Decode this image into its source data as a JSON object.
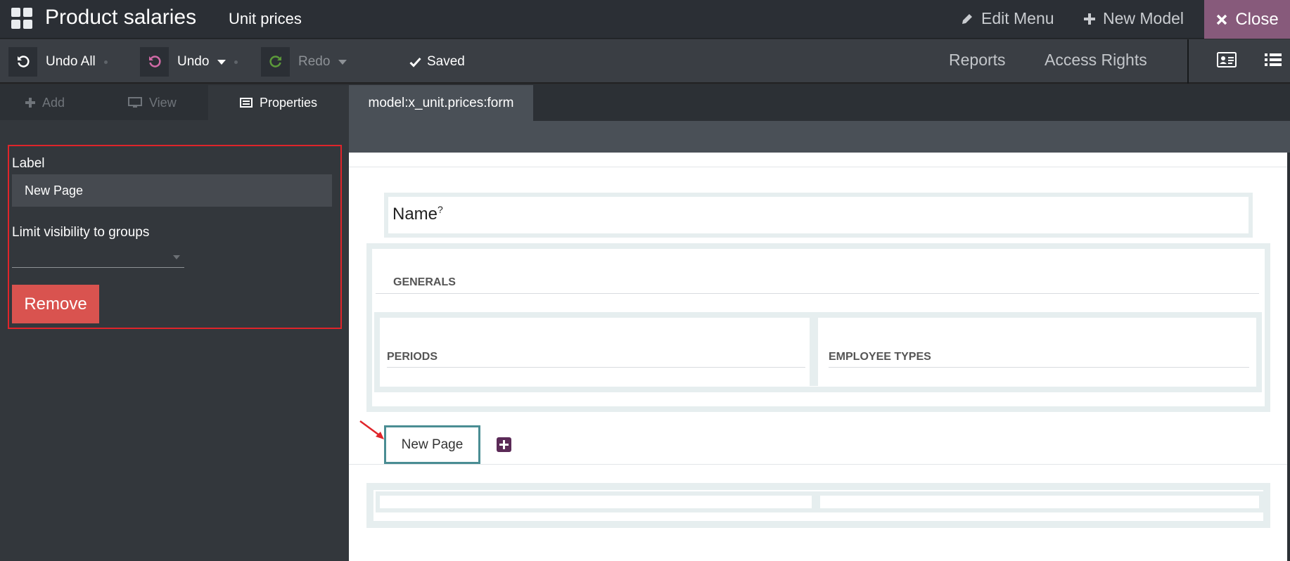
{
  "header": {
    "app_title": "Product salaries",
    "model_title": "Unit prices",
    "edit_menu": "Edit Menu",
    "new_model": "New Model",
    "close": "Close"
  },
  "toolbar": {
    "undo_all": "Undo All",
    "undo": "Undo",
    "redo": "Redo",
    "saved": "Saved",
    "reports": "Reports",
    "access_rights": "Access Rights"
  },
  "sidebar": {
    "tabs": {
      "add": "Add",
      "view": "View",
      "properties": "Properties"
    },
    "active_tab": "Properties",
    "label_field_label": "Label",
    "label_value": "New Page",
    "groups_label": "Limit visibility to groups",
    "groups_value": "",
    "remove": "Remove"
  },
  "main": {
    "view_tab": "model:x_unit.prices:form",
    "name_label": "Name",
    "name_help": "?",
    "generals": "GENERALS",
    "periods": "PERIODS",
    "employee_types": "EMPLOYEE TYPES",
    "new_page_tab": "New Page"
  },
  "colors": {
    "accent": "#875a7b",
    "remove": "#d9534f",
    "highlight_box": "#e0242a",
    "selected_tab_border": "#4a8d93"
  },
  "icons": {
    "apps": "apps-grid-icon",
    "edit": "pencil-icon",
    "new": "plus-icon",
    "close": "close-x-icon",
    "undo_all": "undo-all-icon",
    "undo": "undo-icon",
    "redo": "redo-icon",
    "saved": "checkmark-icon",
    "form_view": "form-view-icon",
    "list_view": "list-view-icon",
    "add_tab": "plus-icon",
    "view_tab": "monitor-icon",
    "properties_tab": "properties-icon",
    "add_page": "plus-square-icon"
  }
}
